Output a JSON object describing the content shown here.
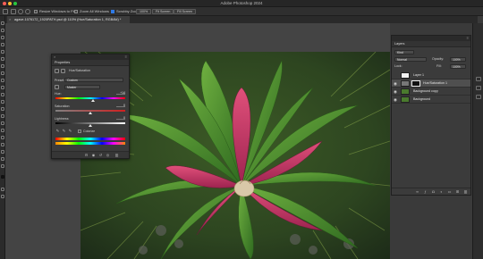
{
  "window": {
    "title": "Adobe Photoshop 2024"
  },
  "options_bar": {
    "scroll_all_windows": "Scroll All Windows",
    "zoom_scrubby_label": "Scrubby Zoom",
    "zoom_pct": "100%",
    "fit_screen": "Fit Screen",
    "fill_screen": "Fill Screen",
    "resize_label": "Resize Windows to Fit",
    "zoom_all_label": "Zoom All Windows"
  },
  "document_tab": {
    "label": "agave-1076172_1920PATH.psd @ 110% (Hue/Saturation 1, RGB/8#) *",
    "close_glyph": "×"
  },
  "properties_panel": {
    "close_glyph": "×",
    "menu_glyph": "≡",
    "tab_label": "Properties",
    "adjustment_name": "Hue/Saturation",
    "preset_label": "Preset:",
    "preset_value": "Custom",
    "channel_value": "Master",
    "hue_label": "Hue:",
    "hue_value": "+14",
    "saturation_label": "Saturation:",
    "saturation_value": "0",
    "lightness_label": "Lightness:",
    "lightness_value": "0",
    "colorize_label": "Colorize",
    "hue_level": 0.54,
    "saturation_level": 0.5,
    "lightness_level": 0.5
  },
  "layers_panel": {
    "tab_label": "Layers",
    "filter_kind": "Kind",
    "blend_mode": "Normal",
    "opacity_label": "Opacity:",
    "opacity_value": "100%",
    "lock_label": "Lock:",
    "fill_label": "Fill:",
    "fill_value": "100%",
    "layers": [
      {
        "name": "Layer 1",
        "visible": false,
        "active": false
      },
      {
        "name": "Hue/Saturation 1",
        "visible": true,
        "active": true
      },
      {
        "name": "Background copy",
        "visible": true,
        "active": false
      },
      {
        "name": "Background",
        "visible": true,
        "active": false
      }
    ]
  },
  "colors": {
    "accent": "#2f7ae5",
    "panel_bg": "#3b3b3b",
    "app_bg": "#3a3a3a",
    "leaf_green": "#4a8a2c",
    "leaf_magenta": "#c23a6a"
  },
  "icons": {
    "eye": "eye-icon",
    "chain": "link-icon",
    "trash": "trash-icon",
    "hand": "hand-icon",
    "zoom": "zoom-icon"
  }
}
